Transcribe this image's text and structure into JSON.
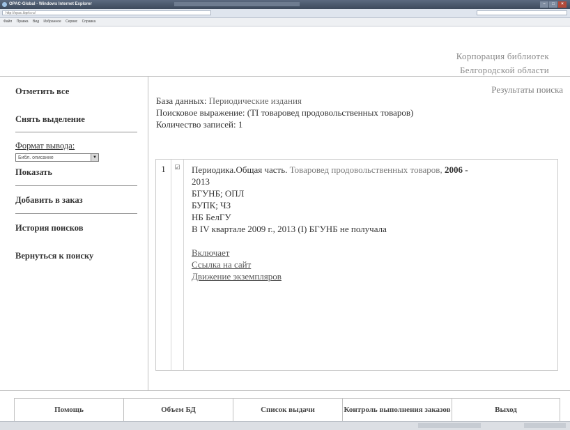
{
  "window": {
    "title": "OPAC-Global - Windows Internet Explorer",
    "url": "http://opac.ibprb.ru/"
  },
  "browser_menu": [
    "Файл",
    "Правка",
    "Вид",
    "Избранное",
    "Сервис",
    "Справка"
  ],
  "header": {
    "org_line1": "Корпорация библиотек",
    "org_line2": "Белгородской области"
  },
  "sidebar": {
    "select_all": "Отметить все",
    "deselect": "Снять выделение",
    "format_label": "Формат вывода:",
    "format_selected": "Библ. описание",
    "show": "Показать",
    "add_to_order": "Добавить в заказ",
    "history": "История поисков",
    "back_to_search": "Вернуться к поиску"
  },
  "results": {
    "heading": "Результаты поиска",
    "database_label": "База данных:",
    "database_value": "Периодические издания",
    "query_label": "Поисковое выражение:",
    "query_value": "(TI товаровед продовольственных товаров)",
    "count_label": "Количество записей:",
    "count_value": "1"
  },
  "record": {
    "number": "1",
    "source": "Периодика.Общая часть.",
    "title": "Товаровед продовольственных товаров,",
    "years": "2006 -",
    "years_end": "2013",
    "holdings": [
      "БГУНБ; ОПЛ",
      "БУПК; ЧЗ",
      "НБ БелГУ"
    ],
    "note": "В IV квартале 2009 г., 2013 (I) БГУНБ не получала",
    "links": [
      "Включает",
      "Ссылка на сайт",
      "Движение экземпляров"
    ]
  },
  "footer": {
    "buttons": [
      "Помощь",
      "Объем БД",
      "Список выдачи",
      "Контроль выполнения заказов",
      "Выход"
    ]
  }
}
